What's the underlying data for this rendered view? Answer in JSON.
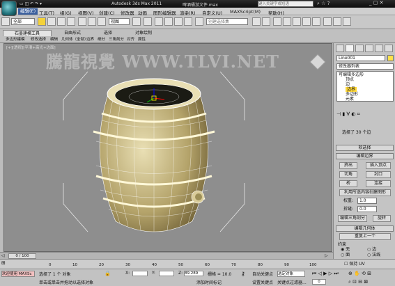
{
  "title": {
    "app": "Autodesk 3ds Max  2011",
    "file": "啤酒桶游文件.max",
    "search_placeholder": "键入关键字或短语"
  },
  "menu": [
    "编辑(E)",
    "工具(T)",
    "组(G)",
    "视图(V)",
    "创建(C)",
    "修改器",
    "动画",
    "图形编辑器",
    "渲染(R)",
    "自定义(U)",
    "MAXScript(M)",
    "帮助(H)"
  ],
  "toolbar": {
    "filter": "全部",
    "coord": "视图",
    "selset": "创建选择集"
  },
  "ribbon": {
    "tabs": [
      "石墨建模工具",
      "自由形式",
      "选择",
      "对象绘制"
    ],
    "subitems": [
      "多边形建模",
      "修改选择",
      "编辑",
      "几何体（全部）",
      "边界",
      "细分",
      "三角剖分",
      "对齐",
      "属性"
    ]
  },
  "viewport": {
    "label": "[+][透视][平滑+高光+边面]",
    "watermark": "騰龍視覺 WWW.TLVI.NET"
  },
  "panel": {
    "object_name": "Line001",
    "modifier_list": "修改器列表",
    "stack": [
      "可编辑多边形",
      "顶点",
      "边",
      "边界",
      "多边形",
      "元素"
    ],
    "selection_status": "选择了 30 个边",
    "rollout_soft": "软选择",
    "rollout_edit_border": "编辑边界",
    "buttons_row1": [
      "挤出",
      "插入顶点"
    ],
    "buttons_row2": [
      "切角",
      "封口"
    ],
    "buttons_row3": [
      "桥",
      "连接"
    ],
    "create_shape": "利用所选内容创建图形",
    "weight_label": "权重:",
    "weight_value": "1.0",
    "crease_label": "折缝:",
    "crease_value": "0.0",
    "edit_tri": "编辑三角剖分",
    "rotate": "旋转",
    "rollout_geometry": "编辑几何体",
    "repeat_last": "重复上一个",
    "constraint_title": "约束",
    "constraint_none": "无",
    "constraint_edge": "边",
    "constraint_face": "面",
    "constraint_normal": "法线",
    "preserve_uv": "保持 UV"
  },
  "timeline": {
    "frame": "0 / 100",
    "ticks": [
      "0",
      "10",
      "20",
      "30",
      "40",
      "50",
      "60",
      "70",
      "80",
      "90",
      "100"
    ]
  },
  "status": {
    "welcome": "欢迎使用 MAXSc",
    "selected": "选择了 1 个 对象",
    "prompt": "单击或单击并拖动以选择对象",
    "x": "89.289",
    "grid": "栅格 = 10.0",
    "add_tag": "添加时间标记",
    "autokey": "自动关键点",
    "setkey": "设置关键点",
    "selected_obj": "选定对象",
    "key_filter": "关键点过滤器...",
    "frame_num": "0"
  }
}
